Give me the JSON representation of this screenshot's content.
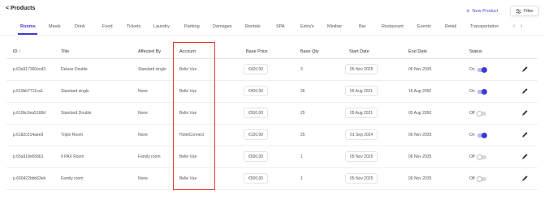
{
  "header": {
    "back_label": "< Products",
    "new_product_label": "New Product",
    "filter_label": "Filter"
  },
  "tabs": [
    {
      "label": "Rooms",
      "active": true
    },
    {
      "label": "Meals"
    },
    {
      "label": "Drink"
    },
    {
      "label": "Food"
    },
    {
      "label": "Tickets"
    },
    {
      "label": "Laundry"
    },
    {
      "label": "Parking"
    },
    {
      "label": "Damages"
    },
    {
      "label": "Rentals"
    },
    {
      "label": "SPA"
    },
    {
      "label": "Extra's"
    },
    {
      "label": "Minibar"
    },
    {
      "label": "Bar"
    },
    {
      "label": "Restaurant"
    },
    {
      "label": "Events"
    },
    {
      "label": "Retail"
    },
    {
      "label": "Transportation"
    }
  ],
  "table": {
    "columns": [
      "ID ↑",
      "Title",
      "Affected By",
      "Account",
      "Base Price",
      "Base Qty",
      "Start Date",
      "End Date",
      "Status"
    ],
    "rows": [
      {
        "id": "p.63a917360ecd3",
        "title": "Deluxe Double",
        "affected_by": "Standard single",
        "account": "Belle Vue",
        "price": "€420.00",
        "qty": "3",
        "start": "05 Nov 2025",
        "end": "06 Nov 2035",
        "status": "On"
      },
      {
        "id": "p.610bb7711ca1",
        "title": "Standard single",
        "affected_by": "None",
        "account": "Belle Vue",
        "price": "€400.00",
        "qty": "26",
        "start": "05 Aug 2021",
        "end": "18 Aug 2050",
        "status": "On"
      },
      {
        "id": "p.610bc0ea5168d",
        "title": "Standard Double",
        "affected_by": "None",
        "account": "Belle Vue",
        "price": "€500.00",
        "qty": "25",
        "start": "05 Aug 2021",
        "end": "05 Aug 2050",
        "status": "Off"
      },
      {
        "id": "p.6182c514aee9",
        "title": "Triple Room",
        "affected_by": "None",
        "account": "HotelConnect",
        "price": "€120.00",
        "qty": "25",
        "start": "01 Sep 2024",
        "end": "06 Nov 2035",
        "status": "On"
      },
      {
        "id": "p.65a918e656b1",
        "title": "9 PAX Room",
        "affected_by": "Family room",
        "account": "Belle Vue",
        "price": "€500.00",
        "qty": "1",
        "start": "05 Nov 2025",
        "end": "06 Nov 2035",
        "status": "Off"
      },
      {
        "id": "p.660422bbb63eb",
        "title": "Family room",
        "affected_by": "None",
        "account": "Belle Vue",
        "price": "€500.00",
        "qty": "1",
        "start": "05 Nov 2025",
        "end": "06 Nov 2035",
        "status": "Off"
      }
    ]
  },
  "colors": {
    "accent": "#3b3bd4",
    "highlight": "#e53935"
  }
}
